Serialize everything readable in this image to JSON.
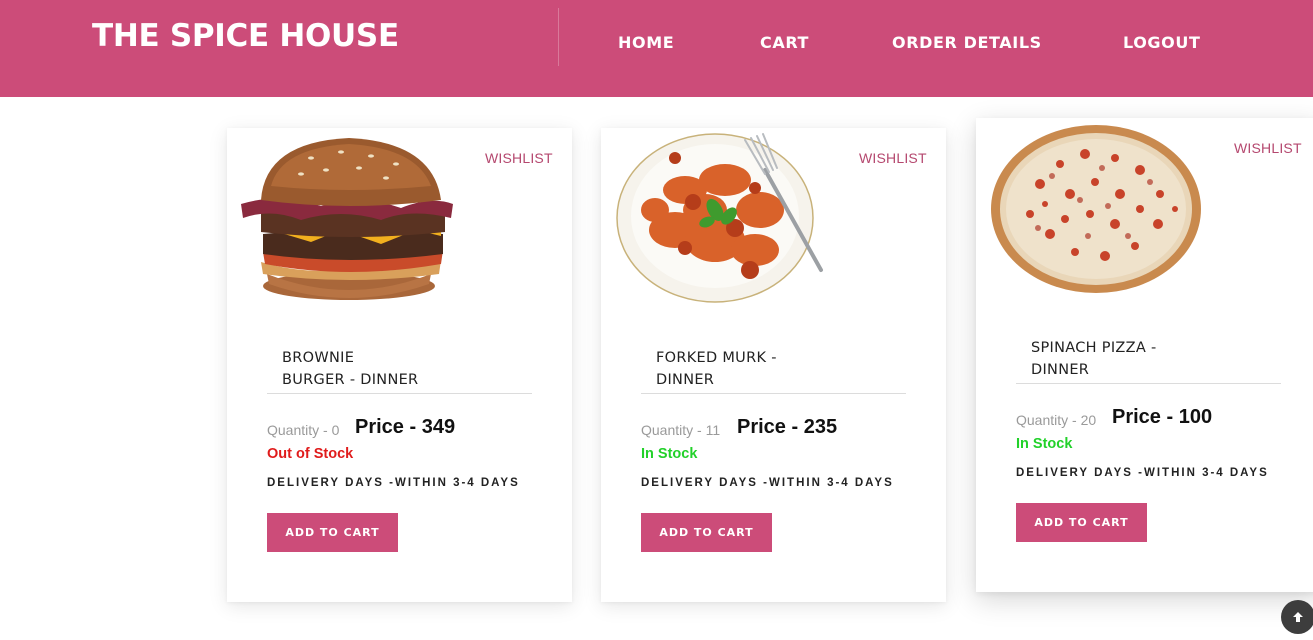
{
  "header": {
    "brand": "THE SPICE HOUSE",
    "nav": [
      "HOME",
      "CART",
      "ORDER DETAILS",
      "LOGOUT"
    ]
  },
  "colors": {
    "accent": "#cc4c79",
    "in_stock": "#22d12a",
    "out_of_stock": "#e01b1b"
  },
  "products": [
    {
      "title_line1": "BROWNIE",
      "title_line2": "BURGER - DINNER",
      "wishlist": "WISHLIST",
      "quantity": "Quantity - 0",
      "price": "Price - 349",
      "stock": "Out of Stock",
      "delivery": "DELIVERY DAYS -WITHIN 3-4 DAYS",
      "button": "ADD TO CART",
      "image_icon": "burger-image"
    },
    {
      "title_line1": "FORKED MURK -",
      "title_line2": "DINNER",
      "wishlist": "WISHLIST",
      "quantity": "Quantity - 11",
      "price": "Price - 235",
      "stock": "In Stock",
      "delivery": "DELIVERY DAYS -WITHIN 3-4 DAYS",
      "button": "ADD TO CART",
      "image_icon": "pasta-image"
    },
    {
      "title_line1": "SPINACH PIZZA -",
      "title_line2": "DINNER",
      "wishlist": "WISHLIST",
      "quantity": "Quantity - 20",
      "price": "Price - 100",
      "stock": "In Stock",
      "delivery": "DELIVERY DAYS -WITHIN 3-4 DAYS",
      "button": "ADD TO CART",
      "image_icon": "pizza-image"
    }
  ],
  "scroll_top_icon": "arrow-up-icon"
}
